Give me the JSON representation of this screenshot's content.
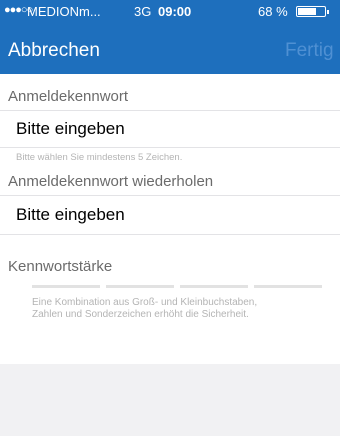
{
  "status": {
    "signal": "●●●○○",
    "carrier": "MEDIONm...",
    "network": "3G",
    "time": "09:00",
    "battery_pct": "68 %",
    "battery_level": 0.68
  },
  "nav": {
    "cancel_label": "Abbrechen",
    "done_label": "Fertig"
  },
  "password": {
    "label": "Anmeldekennwort",
    "placeholder": "Bitte eingeben",
    "hint": "Bitte wählen Sie mindestens 5 Zeichen."
  },
  "password_repeat": {
    "label": "Anmeldekennwort wiederholen",
    "placeholder": "Bitte eingeben"
  },
  "strength": {
    "label": "Kennwortstärke",
    "level": 0,
    "hint_line1": "Eine Kombination aus Groß- und Kleinbuchstaben,",
    "hint_line2": "Zahlen und Sonderzeichen erhöht die Sicherheit."
  },
  "colors": {
    "accent": "#1e6fbd",
    "done_disabled": "#4f90d3",
    "background": "#f1f1f3",
    "strength_empty": "#e2e2e2"
  }
}
